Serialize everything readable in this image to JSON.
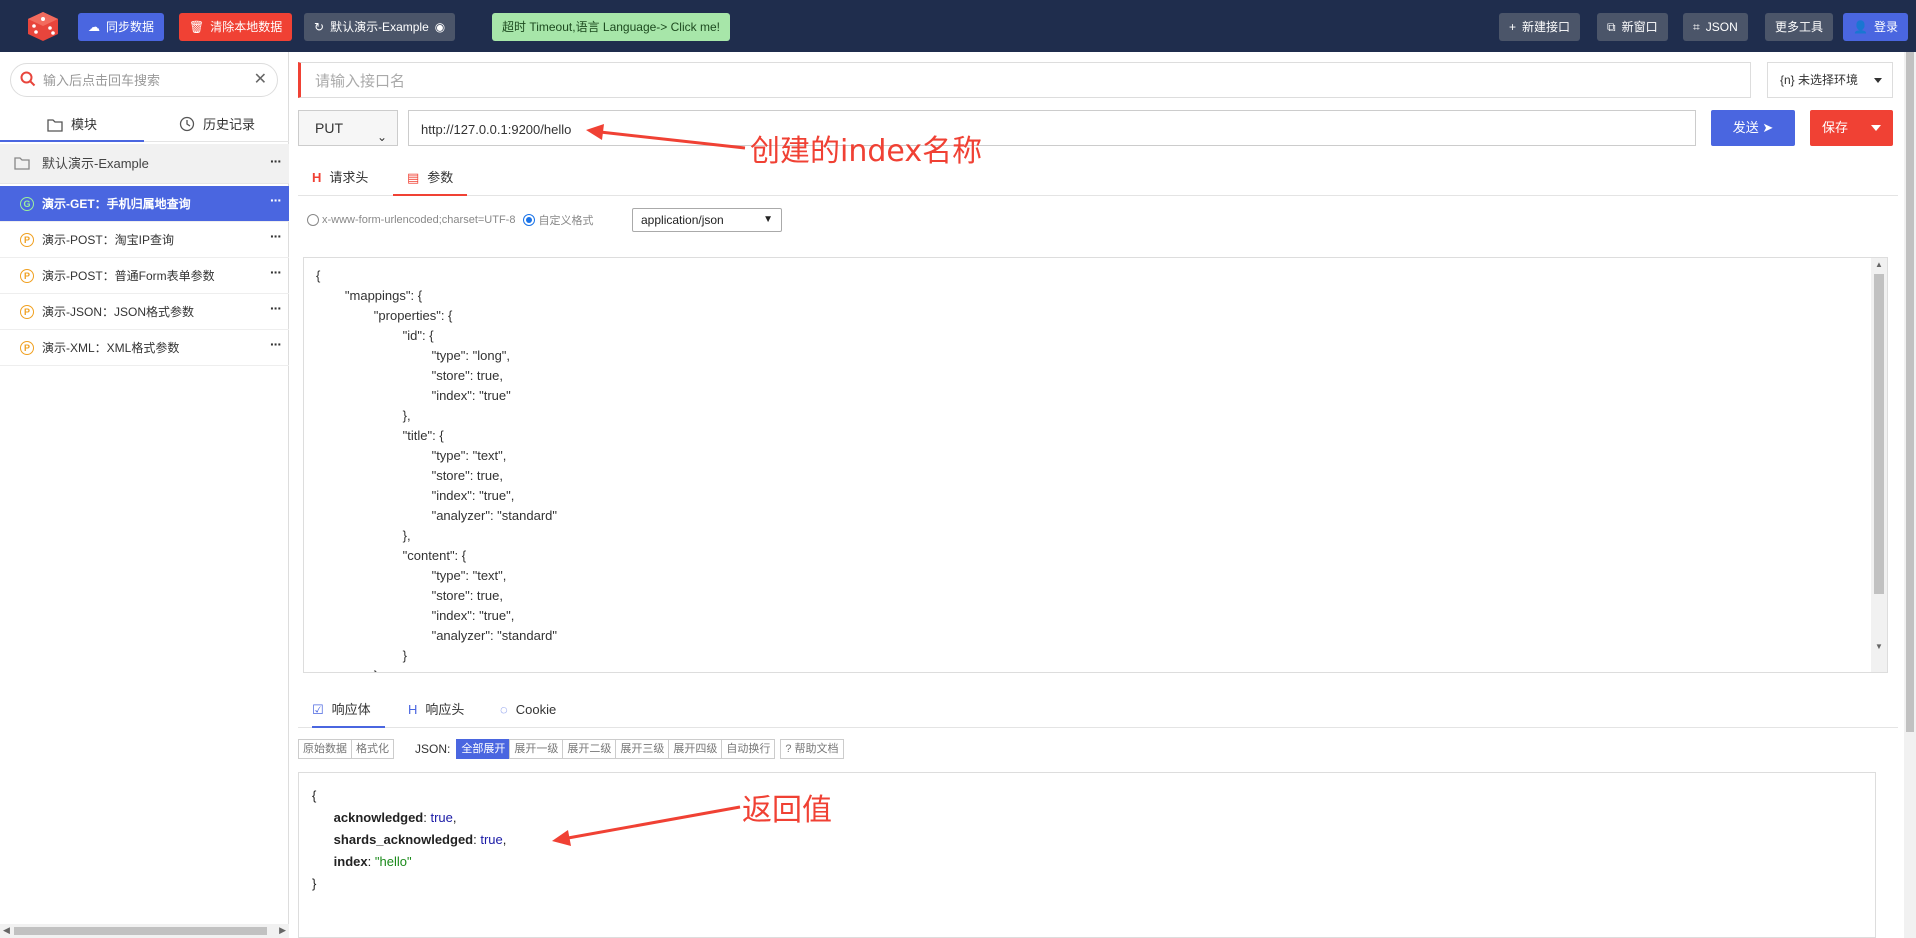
{
  "topbar": {
    "sync": "同步数据",
    "clear": "清除本地数据",
    "project": "默认演示-Example",
    "timeout": "超时 Timeout,语言 Language-> Click me!",
    "new_api": "新建接口",
    "new_window": "新窗口",
    "json": "JSON",
    "more_tools": "更多工具",
    "login": "登录"
  },
  "sidebar": {
    "search_placeholder": "输入后点击回车搜索",
    "tabs": [
      "模块",
      "历史记录"
    ],
    "group": "默认演示-Example",
    "items": [
      {
        "badge": "G",
        "label": "演示-GET：手机归属地查询",
        "active": true
      },
      {
        "badge": "P",
        "label": "演示-POST：淘宝IP查询"
      },
      {
        "badge": "P",
        "label": "演示-POST：普通Form表单参数"
      },
      {
        "badge": "P",
        "label": "演示-JSON：JSON格式参数"
      },
      {
        "badge": "P",
        "label": "演示-XML：XML格式参数"
      }
    ]
  },
  "request": {
    "name_placeholder": "请输入接口名",
    "env": "{n} 未选择环境",
    "method": "PUT",
    "url": "http://127.0.0.1:9200/hello",
    "send": "发送",
    "save": "保存",
    "tabs": [
      "请求头",
      "参数"
    ],
    "form_option": "x-www-form-urlencoded;charset=UTF-8",
    "custom_option": "自定义格式",
    "content_type": "application/json",
    "body": "{\n        \"mappings\": {\n                \"properties\": {\n                        \"id\": {\n                                \"type\": \"long\",\n                                \"store\": true,\n                                \"index\": \"true\"\n                        },\n                        \"title\": {\n                                \"type\": \"text\",\n                                \"store\": true,\n                                \"index\": \"true\",\n                                \"analyzer\": \"standard\"\n                        },\n                        \"content\": {\n                                \"type\": \"text\",\n                                \"store\": true,\n                                \"index\": \"true\",\n                                \"analyzer\": \"standard\"\n                        }\n                }"
  },
  "response": {
    "tabs": [
      "响应体",
      "响应头",
      "Cookie"
    ],
    "raw": "原始数据",
    "format": "格式化",
    "json_label": "JSON:",
    "levels": [
      "全部展开",
      "展开一级",
      "展开二级",
      "展开三级",
      "展开四级",
      "自动换行"
    ],
    "help": "帮助文档",
    "fields": [
      {
        "key": "acknowledged",
        "value": "true",
        "kind": "bool",
        "comma": true
      },
      {
        "key": "shards_acknowledged",
        "value": "true",
        "kind": "bool",
        "comma": true
      },
      {
        "key": "index",
        "value": "\"hello\"",
        "kind": "str",
        "comma": false
      }
    ]
  },
  "annotations": {
    "index_name": "创建的index名称",
    "return_value": "返回值"
  },
  "colors": {
    "topbar": "#1f2d4d",
    "primary": "#4a66e0",
    "danger": "#f04134",
    "timeout": "#a7e6a9"
  }
}
